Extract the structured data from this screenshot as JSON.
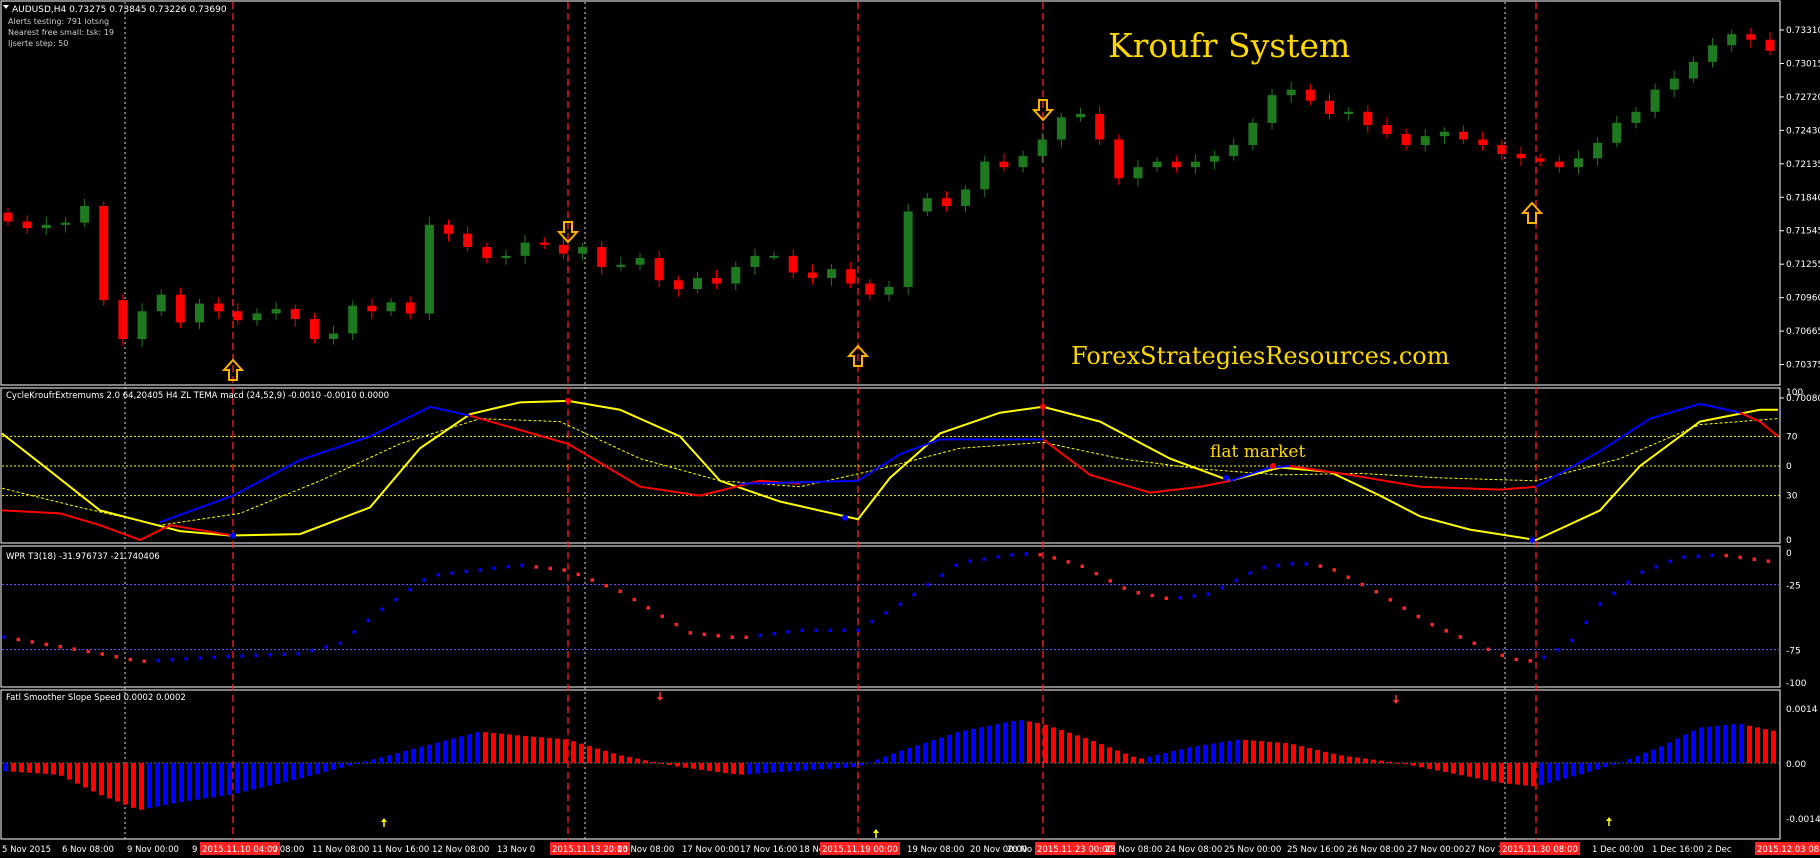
{
  "symbol_info": {
    "header": "AUDUSD,H4  0.73275 0.73845 0.73226 0.73690",
    "line1": "Alerts testing: 791 lotsng",
    "line2": "Nearest free small: tsk: 19",
    "line3": "Ijserte step: 50"
  },
  "brand": {
    "title": "Kroufr System",
    "website": "ForexStrategiesResources.com",
    "annotation": "flat market"
  },
  "colors": {
    "bull": "#1f7a1f",
    "bear": "#ff0000",
    "axis": "#ffffff",
    "grid": "#bfbfbf",
    "label_bg": "#ff0000",
    "level": "#ffff00",
    "blue": "#0000ff",
    "yellow": "#ffff00"
  },
  "price_axis": [
    "0.73310",
    "0.73015",
    "0.72720",
    "0.72430",
    "0.72135",
    "0.71840",
    "0.71545",
    "0.71255",
    "0.70960",
    "0.70665",
    "0.70375",
    "0.70080"
  ],
  "panels": {
    "cycle": {
      "title": "CycleKroufrExtremums 2.0 64,20405  H4 ZL TEMA macd (24,52,9) -0.0010 -0.0010 0.0000",
      "levels": [
        "100",
        "70",
        "0",
        "30",
        "0"
      ]
    },
    "wpr": {
      "title": "WPR T3(18) -31.976737 -21.740406",
      "levels": [
        "0",
        "-25",
        "-75",
        "-100"
      ]
    },
    "fatl": {
      "title": "Fatl Smoother Slope Speed 0.0002 0.0002",
      "levels": [
        "0.0014",
        "0.00",
        "-0.0014"
      ]
    }
  },
  "time_axis": [
    {
      "label": "5 Nov 2015",
      "hl": false
    },
    {
      "label": "6 Nov 08:00",
      "hl": false
    },
    {
      "label": "9 Nov 00:00",
      "hl": false
    },
    {
      "label": "9",
      "hl": false
    },
    {
      "label": "2015.11.10 04:00",
      "hl": true
    },
    {
      "label": "v 08:00",
      "hl": false
    },
    {
      "label": "11 Nov 08:00",
      "hl": false
    },
    {
      "label": "11 Nov 16:00",
      "hl": false
    },
    {
      "label": "12 Nov 08:00",
      "hl": false
    },
    {
      "label": "13 Nov 0",
      "hl": false
    },
    {
      "label": "2015.11.13 20:00",
      "hl": true
    },
    {
      "label": "16 Nov 08:00",
      "hl": false
    },
    {
      "label": "17 Nov 00:00",
      "hl": false
    },
    {
      "label": "17 Nov 16:00",
      "hl": false
    },
    {
      "label": "18 No",
      "hl": false
    },
    {
      "label": "2015.11.19 00:00",
      "hl": true
    },
    {
      "label": "19 Nov 08:00",
      "hl": false
    },
    {
      "label": "20 Nov 00:00",
      "hl": false
    },
    {
      "label": "20 No",
      "hl": false
    },
    {
      "label": "2015.11.23 00:00",
      "hl": true
    },
    {
      "label": "23 Nov 08:00",
      "hl": false
    },
    {
      "label": "24 Nov 08:00",
      "hl": false
    },
    {
      "label": "25 Nov 00:00",
      "hl": false
    },
    {
      "label": "25 Nov 16:00",
      "hl": false
    },
    {
      "label": "26 Nov 08:00",
      "hl": false
    },
    {
      "label": "27 Nov 00:00",
      "hl": false
    },
    {
      "label": "27 Nov 16:00",
      "hl": false
    },
    {
      "label": "2015.11.30 08:00",
      "hl": true
    },
    {
      "label": "1 Dec 00:00",
      "hl": false
    },
    {
      "label": "1 Dec 16:00",
      "hl": false
    },
    {
      "label": "2 Dec",
      "hl": false
    },
    {
      "label": "2015.12.03 08:00",
      "hl": true
    }
  ],
  "chart_data": {
    "type": "candlestick",
    "symbol": "AUDUSD",
    "timeframe": "H4",
    "ylim": [
      0.7008,
      0.7331
    ],
    "candles_approx_close": [
      0.7151,
      0.7145,
      0.7148,
      0.715,
      0.7165,
      0.708,
      0.7045,
      0.707,
      0.7085,
      0.706,
      0.7077,
      0.707,
      0.7062,
      0.7068,
      0.7072,
      0.7063,
      0.7045,
      0.705,
      0.7075,
      0.707,
      0.7078,
      0.7068,
      0.7148,
      0.714,
      0.7128,
      0.7118,
      0.712,
      0.7132,
      0.713,
      0.7122,
      0.7128,
      0.711,
      0.7112,
      0.7118,
      0.7098,
      0.709,
      0.71,
      0.7095,
      0.711,
      0.712,
      0.712,
      0.7105,
      0.71,
      0.7108,
      0.7095,
      0.7085,
      0.7092,
      0.716,
      0.7172,
      0.7165,
      0.718,
      0.7205,
      0.72,
      0.721,
      0.7225,
      0.7245,
      0.7248,
      0.7225,
      0.719,
      0.72,
      0.7205,
      0.72,
      0.7205,
      0.721,
      0.722,
      0.724,
      0.7265,
      0.727,
      0.726,
      0.7248,
      0.725,
      0.7238,
      0.723,
      0.722,
      0.7228,
      0.7232,
      0.7225,
      0.722,
      0.7212,
      0.7208,
      0.7205,
      0.72,
      0.7208,
      0.7222,
      0.724,
      0.725,
      0.727,
      0.728,
      0.7295,
      0.731,
      0.732,
      0.7315,
      0.7305
    ],
    "arrow_signals": [
      "up",
      "down",
      "up",
      "down",
      "up"
    ],
    "vertical_markers": [
      "2015.11.10 04:00",
      "2015.11.13 20:00",
      "2015.11.19 00:00",
      "2015.11.23 00:00",
      "2015.11.30 08:00"
    ]
  }
}
